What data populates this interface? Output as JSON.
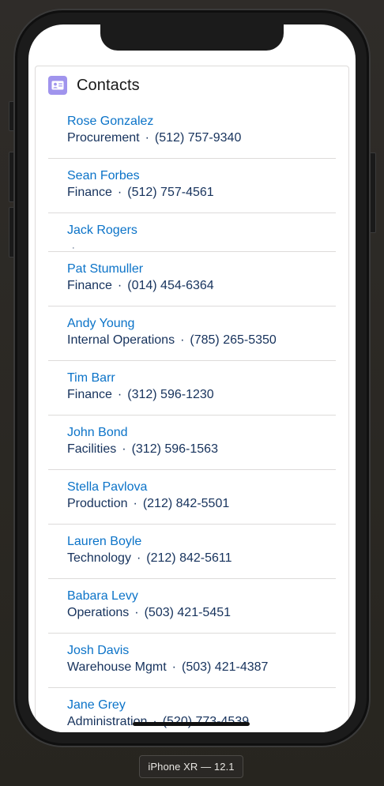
{
  "device": {
    "label": "iPhone XR — 12.1"
  },
  "card": {
    "title": "Contacts",
    "icon": "contact-card-icon",
    "icon_color": "#a094ed"
  },
  "colors": {
    "link": "#0b73c8",
    "text": "#16325c",
    "border": "#dddbda"
  },
  "contacts": [
    {
      "name": "Rose Gonzalez",
      "department": "Procurement",
      "phone": "(512) 757-9340"
    },
    {
      "name": "Sean Forbes",
      "department": "Finance",
      "phone": "(512) 757-4561"
    },
    {
      "name": "Jack Rogers",
      "department": "",
      "phone": ""
    },
    {
      "name": "Pat Stumuller",
      "department": "Finance",
      "phone": "(014) 454-6364"
    },
    {
      "name": "Andy Young",
      "department": "Internal Operations",
      "phone": "(785) 265-5350"
    },
    {
      "name": "Tim Barr",
      "department": "Finance",
      "phone": "(312) 596-1230"
    },
    {
      "name": "John Bond",
      "department": "Facilities",
      "phone": "(312) 596-1563"
    },
    {
      "name": "Stella Pavlova",
      "department": "Production",
      "phone": "(212) 842-5501"
    },
    {
      "name": "Lauren Boyle",
      "department": "Technology",
      "phone": "(212) 842-5611"
    },
    {
      "name": "Babara Levy",
      "department": "Operations",
      "phone": "(503) 421-5451"
    },
    {
      "name": "Josh Davis",
      "department": "Warehouse Mgmt",
      "phone": "(503) 421-4387"
    },
    {
      "name": "Jane Grey",
      "department": "Administration",
      "phone": "(520) 773-4539"
    }
  ],
  "separator": "·"
}
